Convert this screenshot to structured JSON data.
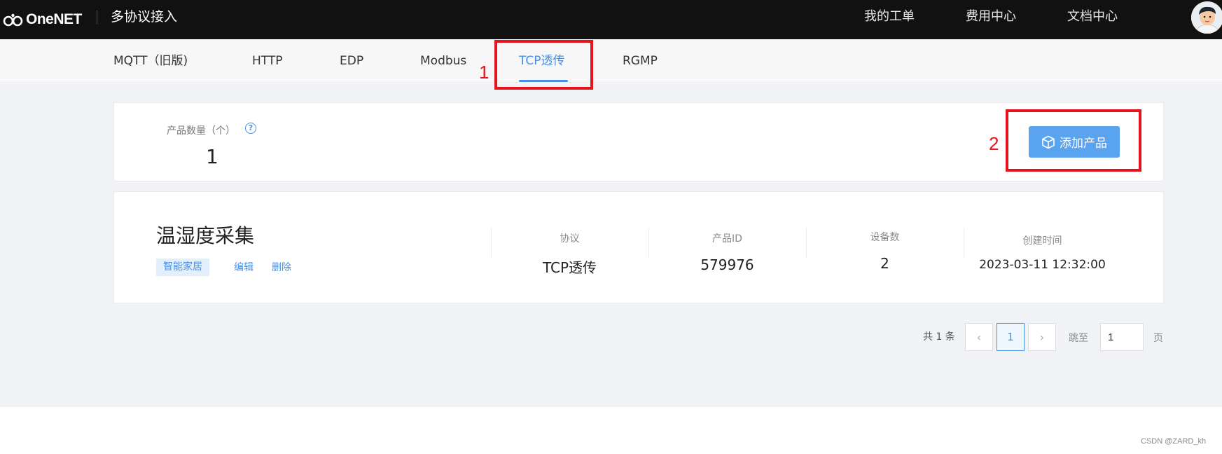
{
  "header": {
    "logo_text": "OneNET",
    "app_title": "多协议接入",
    "nav": [
      "我的工单",
      "费用中心",
      "文档中心"
    ]
  },
  "tabs": [
    {
      "label": "MQTT（旧版)",
      "active": false
    },
    {
      "label": "HTTP",
      "active": false
    },
    {
      "label": "EDP",
      "active": false
    },
    {
      "label": "Modbus",
      "active": false
    },
    {
      "label": "TCP透传",
      "active": true
    },
    {
      "label": "RGMP",
      "active": false
    }
  ],
  "summary": {
    "count_label": "产品数量（个）",
    "help_icon": "?",
    "count_value": "1",
    "add_button_label": "添加产品"
  },
  "product": {
    "name": "温湿度采集",
    "tag": "智能家居",
    "edit_label": "编辑",
    "delete_label": "删除",
    "columns": [
      {
        "label": "协议",
        "value": "TCP透传"
      },
      {
        "label": "产品ID",
        "value": "579976"
      },
      {
        "label": "设备数",
        "value": "2"
      },
      {
        "label": "创建时间",
        "value": "2023-03-11 12:32:00"
      }
    ]
  },
  "pagination": {
    "total_text": "共 1 条",
    "prev": "‹",
    "current_page": "1",
    "next": "›",
    "jump_label": "跳至",
    "jump_value": "1",
    "page_suffix": "页"
  },
  "annotations": [
    "1",
    "2"
  ],
  "watermark": "CSDN @ZARD_kh",
  "colors": {
    "accent": "#4a90e2",
    "annotation_red": "#e3141b",
    "topbar": "#111111",
    "button": "#5aa3ee"
  }
}
